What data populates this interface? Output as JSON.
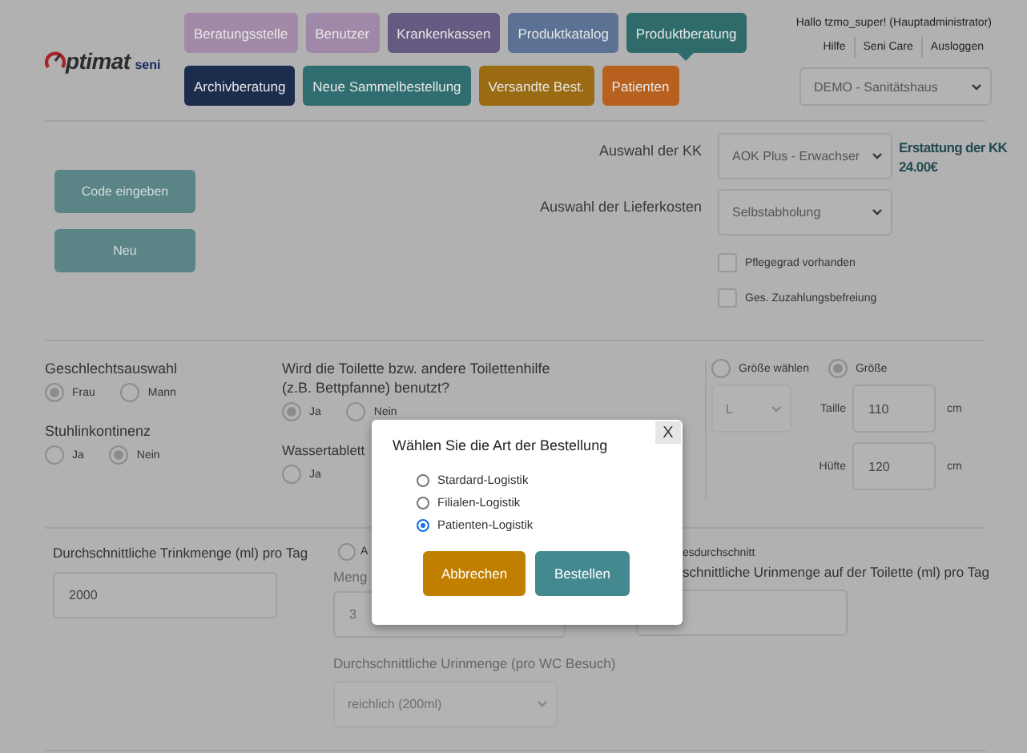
{
  "header": {
    "logo_text": "ptimat",
    "logo_suffix": "seni",
    "nav_rows": [
      [
        {
          "label": "Beratungsstelle",
          "color": "#a08aa8",
          "selected": false
        },
        {
          "label": "Benutzer",
          "color": "#a088a8",
          "selected": false
        },
        {
          "label": "Krankenkassen",
          "color": "#655a82",
          "selected": false
        },
        {
          "label": "Produktkatalog",
          "color": "#5b7294",
          "selected": false
        },
        {
          "label": "Produktberatung",
          "color": "#2f6b6b",
          "selected": true
        }
      ],
      [
        {
          "label": "Archivberatung",
          "color": "#1c2c4c",
          "selected": false
        },
        {
          "label": "Neue Sammelbestellung",
          "color": "#2f6d70",
          "selected": false
        },
        {
          "label": "Versandte Best.",
          "color": "#9a6b12",
          "selected": false
        },
        {
          "label": "Patienten",
          "color": "#b8611e",
          "selected": false
        }
      ]
    ],
    "greeting": "Hallo tzmo_super! (Hauptadministrator)",
    "links": [
      "Hilfe",
      "Seni Care",
      "Ausloggen"
    ],
    "branch": "DEMO - Sanitätshaus"
  },
  "actions": [
    "Code eingeben",
    "Neu"
  ],
  "insurance": {
    "kk_label": "Auswahl der KK",
    "kk_value": "AOK Plus - Erwachser",
    "delivery_label": "Auswahl der Lieferkosten",
    "delivery_value": "Selbstabholung",
    "refund_label": "Erstattung der KK",
    "refund_value": "24.00€",
    "checkboxes": [
      {
        "label": "Pflegegrad vorhanden",
        "checked": false
      },
      {
        "label": "Ges. Zuzahlungsbefreiung",
        "checked": false
      }
    ]
  },
  "patient": {
    "gender": {
      "label": "Geschlechtsauswahl",
      "options": [
        {
          "label": "Frau",
          "selected": true
        },
        {
          "label": "Mann",
          "selected": false
        }
      ]
    },
    "stool": {
      "label": "Stuhlinkontinenz",
      "options": [
        {
          "label": "Ja",
          "selected": false
        },
        {
          "label": "Nein",
          "selected": true
        }
      ]
    },
    "toilet": {
      "label": "Wird die Toilette bzw. andere Toilettenhilfe (z.B. Bettpfanne) benutzt?",
      "options": [
        {
          "label": "Ja",
          "selected": true
        },
        {
          "label": "Nein",
          "selected": false
        }
      ]
    },
    "water": {
      "label": "Wassertablett",
      "options": [
        {
          "label": "Ja",
          "selected": false
        }
      ]
    },
    "size_mode": [
      {
        "label": "Größe wählen",
        "selected": false
      },
      {
        "label": "Größe",
        "selected": true
      }
    ],
    "size_value": "L",
    "measures": [
      {
        "label": "Taille",
        "value": "110",
        "unit": "cm"
      },
      {
        "label": "Hüfte",
        "value": "120",
        "unit": "cm"
      }
    ]
  },
  "intake": {
    "drink_label": "Durchschnittliche Trinkmenge (ml) pro Tag",
    "drink_value": "2000",
    "mode_option": {
      "label": "A",
      "selected": false
    },
    "amount_label": "Meng",
    "amount_value": "3",
    "urine_label": "Durchschnittliche Urinmenge (pro WC Besuch)",
    "urine_value": "reichlich (200ml)",
    "average_label": "esdurchschnitt",
    "toilet_label": "schnittliche Urinmenge auf der Toilette (ml) pro Tag"
  },
  "modal": {
    "title": "Wählen Sie die Art der Bestellung",
    "close": "X",
    "options": [
      {
        "label": "Stardard-Logistik",
        "selected": false
      },
      {
        "label": "Filialen-Logistik",
        "selected": false
      },
      {
        "label": "Patienten-Logistik",
        "selected": true
      }
    ],
    "buttons": [
      {
        "label": "Abbrechen",
        "kind": "cancel"
      },
      {
        "label": "Bestellen",
        "kind": "confirm"
      }
    ]
  }
}
